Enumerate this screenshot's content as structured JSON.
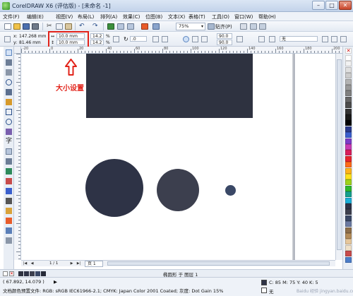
{
  "window": {
    "title": "CorelDRAW X6 (评估版) - [未命名 -1]",
    "min_glyph": "–",
    "max_glyph": "□",
    "close_glyph": "✕"
  },
  "menu": {
    "items": [
      "文件(F)",
      "编辑(E)",
      "视图(V)",
      "布局(L)",
      "排列(A)",
      "效果(C)",
      "位图(B)",
      "文本(X)",
      "表格(T)",
      "工具(O)",
      "窗口(W)",
      "帮助(H)"
    ]
  },
  "toolbar": {
    "zoom_value": "75%",
    "snap_label": "贴齐(P)"
  },
  "propbar": {
    "x_label": "x:",
    "x_value": "147.268 mm",
    "y_label": "y:",
    "y_value": "81.46 mm",
    "width_value": "10.0 mm",
    "height_value": "10.0 mm",
    "scale_w": "14.2",
    "scale_h": "14.2",
    "percent_symbol": "%",
    "rotation_value": ".0",
    "angle_start": "90.0",
    "angle_end": "90.0",
    "outline_label": "无"
  },
  "ruler": {
    "h_numbers": [
      "-20",
      "0",
      "20",
      "40",
      "60",
      "80",
      "100",
      "120",
      "140",
      "160",
      "180",
      "200"
    ]
  },
  "annotation": {
    "label": "大小设置",
    "arrow_color": "#e2231a"
  },
  "pagenav": {
    "first": "|◀",
    "prev": "◀",
    "next": "▶",
    "last": "▶|",
    "counter": "1 / 1",
    "tab_label": "页 1"
  },
  "docpalette_status": "椭圆形 于 图层 1",
  "statusbar": {
    "coords": "( 67.892, 14.079 )",
    "arrow": "▶",
    "color_profile": "文档颜色预置文件: RGB: sRGB IEC61966-2.1; CMYK: Japan Color 2001 Coated; 灰度: Dot Gain 15%",
    "fill_info": "C: 85 M: 75 Y: 40 K: 5",
    "outline_info": "无",
    "watermark": "Baidu 经验 jingyan.baidu.com"
  },
  "colors": {
    "palette": [
      "#ffffff",
      "#f2f2f2",
      "#e0e0e0",
      "#cccccc",
      "#b3b3b3",
      "#999999",
      "#808080",
      "#666666",
      "#4d4d4d",
      "#333333",
      "#1a1a1a",
      "#000000",
      "#2a3a8c",
      "#3a5fcd",
      "#7d3cc8",
      "#c83cb4",
      "#d91e5b",
      "#e8242b",
      "#ff6a1a",
      "#ffb31a",
      "#ffe11a",
      "#9fd21a",
      "#2eb82e",
      "#14a08c",
      "#1ab0d9",
      "#2e3346",
      "#3c3f4e",
      "#3a4866",
      "#6b7aa1",
      "#8d6e4a",
      "#b38c5a",
      "#e6c79c",
      "#f0e0c8",
      "#c84b4b",
      "#4b7dc8"
    ],
    "doc_palette": [
      "#2e3240",
      "#2e3346",
      "#3c3f4e",
      "#3a4866",
      "#262a38"
    ],
    "fill_chip": "#2e3346"
  }
}
